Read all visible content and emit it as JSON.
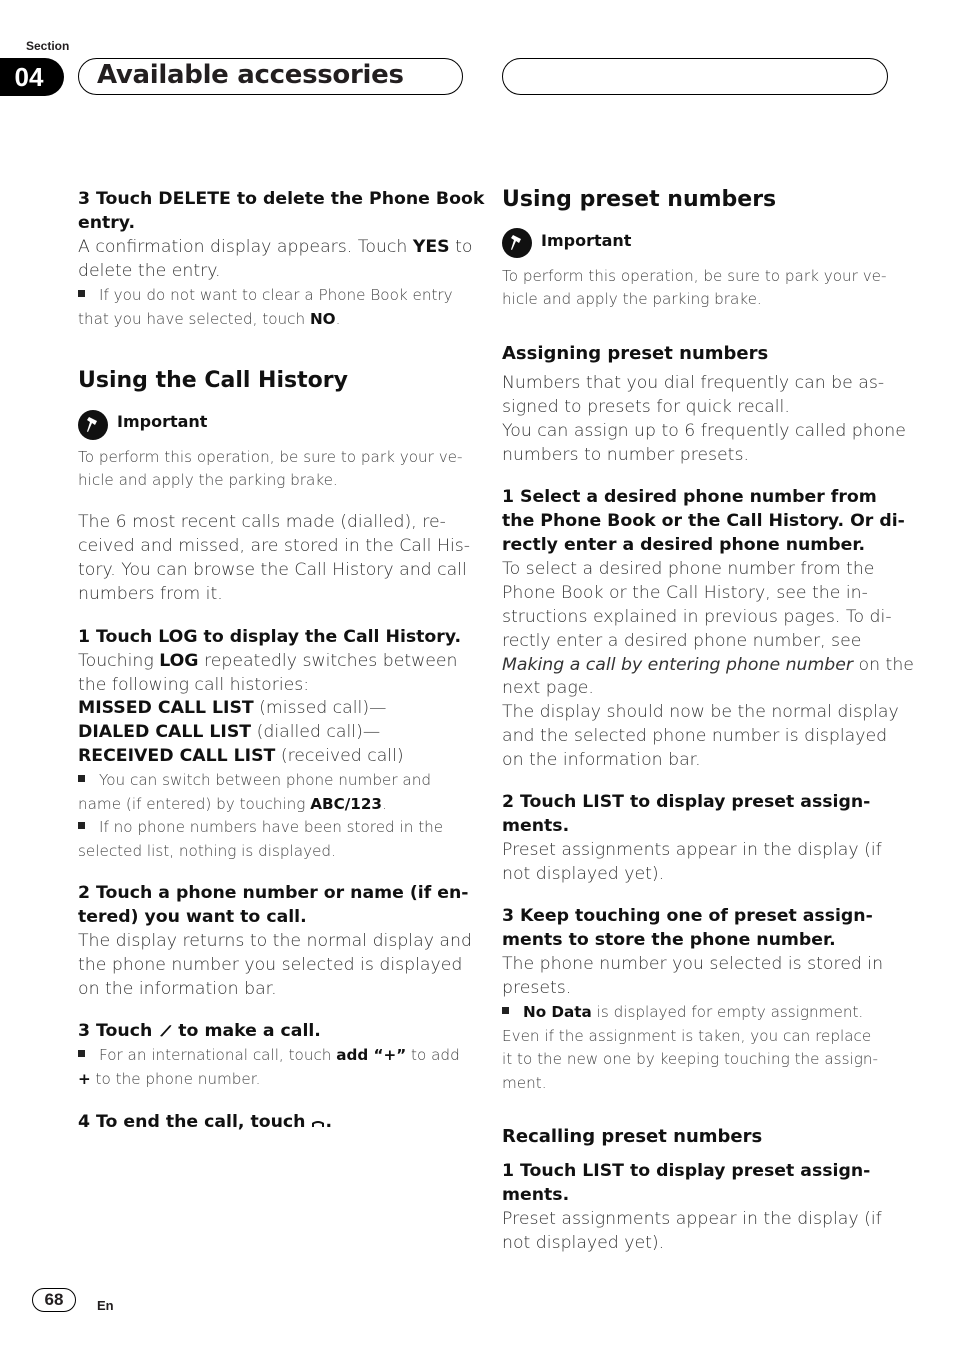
{
  "header": {
    "section_label": "Section",
    "section_number": "04",
    "title": "Available accessories"
  },
  "footer": {
    "page_number": "68",
    "language": "En"
  },
  "left_column": {
    "step3_delete": {
      "heading_l1": "3    Touch DELETE to delete the Phone Book",
      "heading_l2": "entry.",
      "body_l1_a": "A confirmation display appears. Touch ",
      "body_l1_b": "YES",
      "body_l1_c": " to",
      "body_l2": "delete the entry.",
      "note_l1": "If you do not want to clear a Phone Book entry",
      "note_l2_a": "that you have selected, touch ",
      "note_l2_b": "NO",
      "note_l2_c": "."
    },
    "call_history": {
      "heading": "Using the Call History",
      "important_label": "Important",
      "important_l1": "To perform this operation, be sure to park your ve-",
      "important_l2": "hicle and apply the parking brake.",
      "intro_l1": "The 6 most recent calls made (dialled), re-",
      "intro_l2": "ceived and missed, are stored in the Call His-",
      "intro_l3": "tory. You can browse the Call History and call",
      "intro_l4": "numbers from it.",
      "step1_heading": "1    Touch LOG to display the Call History.",
      "step1_l1_a": "Touching ",
      "step1_l1_b": "LOG",
      "step1_l1_c": " repeatedly switches between",
      "step1_l2": "the following call histories:",
      "list": [
        {
          "name": "MISSED CALL LIST",
          "desc": " (missed call)—"
        },
        {
          "name": "DIALED CALL LIST",
          "desc": " (dialled call)—"
        },
        {
          "name": "RECEIVED CALL LIST",
          "desc": " (received call)"
        }
      ],
      "note1_l1": "You can switch between phone number and",
      "note1_l2_a": "name (if entered) by touching ",
      "note1_l2_b": "ABC/123",
      "note1_l2_c": ".",
      "note2_l1": "If no phone numbers have been stored in the",
      "note2_l2": "selected list, nothing is displayed.",
      "step2_heading_l1": "2    Touch a phone number or name (if en-",
      "step2_heading_l2": "tered) you want to call.",
      "step2_l1": "The display returns to the normal display and",
      "step2_l2": "the phone number you selected is displayed",
      "step2_l3": "on the information bar.",
      "step3_heading_a": "3    Touch ",
      "step3_heading_b": " to make a call.",
      "step3_note_l1_a": "For an international call, touch ",
      "step3_note_l1_b": "add “+”",
      "step3_note_l1_c": " to add",
      "step3_note_l2_a": "+",
      "step3_note_l2_b": " to the phone number.",
      "step4_heading_a": "4    To end the call, touch ",
      "step4_heading_b": "."
    }
  },
  "right_column": {
    "preset": {
      "heading": "Using preset numbers",
      "important_label": "Important",
      "important_l1": "To perform this operation, be sure to park your ve-",
      "important_l2": "hicle and apply the parking brake.",
      "assign_heading": "Assigning preset numbers",
      "assign_l1": "Numbers that you dial frequently can be as-",
      "assign_l2": "signed to presets for quick recall.",
      "assign_l3": "You can assign up to 6 frequently called phone",
      "assign_l4": "numbers to number presets.",
      "step1_heading_l1": "1    Select a desired phone number from",
      "step1_heading_l2": "the Phone Book or the Call History. Or di-",
      "step1_heading_l3": "rectly enter a desired phone number.",
      "step1_l1": "To select a desired phone number from the",
      "step1_l2": "Phone Book or the Call History, see the in-",
      "step1_l3": "structions explained in previous pages. To di-",
      "step1_l4": "rectly enter a desired phone number, see",
      "step1_l5_a": "Making a call by entering phone number",
      "step1_l5_b": " on the",
      "step1_l6": "next page.",
      "step1_l7": "The display should now be the normal display",
      "step1_l8": "and the selected phone number is displayed",
      "step1_l9": "on the information bar.",
      "step2_heading_l1": "2    Touch LIST to display preset assign-",
      "step2_heading_l2": "ments.",
      "step2_l1": "Preset assignments appear in the display (if",
      "step2_l2": "not displayed yet).",
      "step3_heading_l1": "3    Keep touching one of preset assign-",
      "step3_heading_l2": "ments to store the phone number.",
      "step3_l1": "The phone number you selected is stored in",
      "step3_l2": "presets.",
      "step3_note_l1_a": "No Data",
      "step3_note_l1_b": " is displayed for empty assignment.",
      "step3_note_l2": "Even if the assignment is taken, you can replace",
      "step3_note_l3": "it to the new one by keeping touching the assign-",
      "step3_note_l4": "ment.",
      "recall_heading": "Recalling preset numbers",
      "recall_step1_l1": "1    Touch LIST to display preset assign-",
      "recall_step1_l2": "ments.",
      "recall_l1": "Preset assignments appear in the display (if",
      "recall_l2": "not displayed yet)."
    }
  },
  "icons": {
    "important": "pushpin-icon",
    "call": "phone-handset-icon",
    "end_call": "hang-up-icon",
    "bullet": "square-bullet-icon"
  }
}
